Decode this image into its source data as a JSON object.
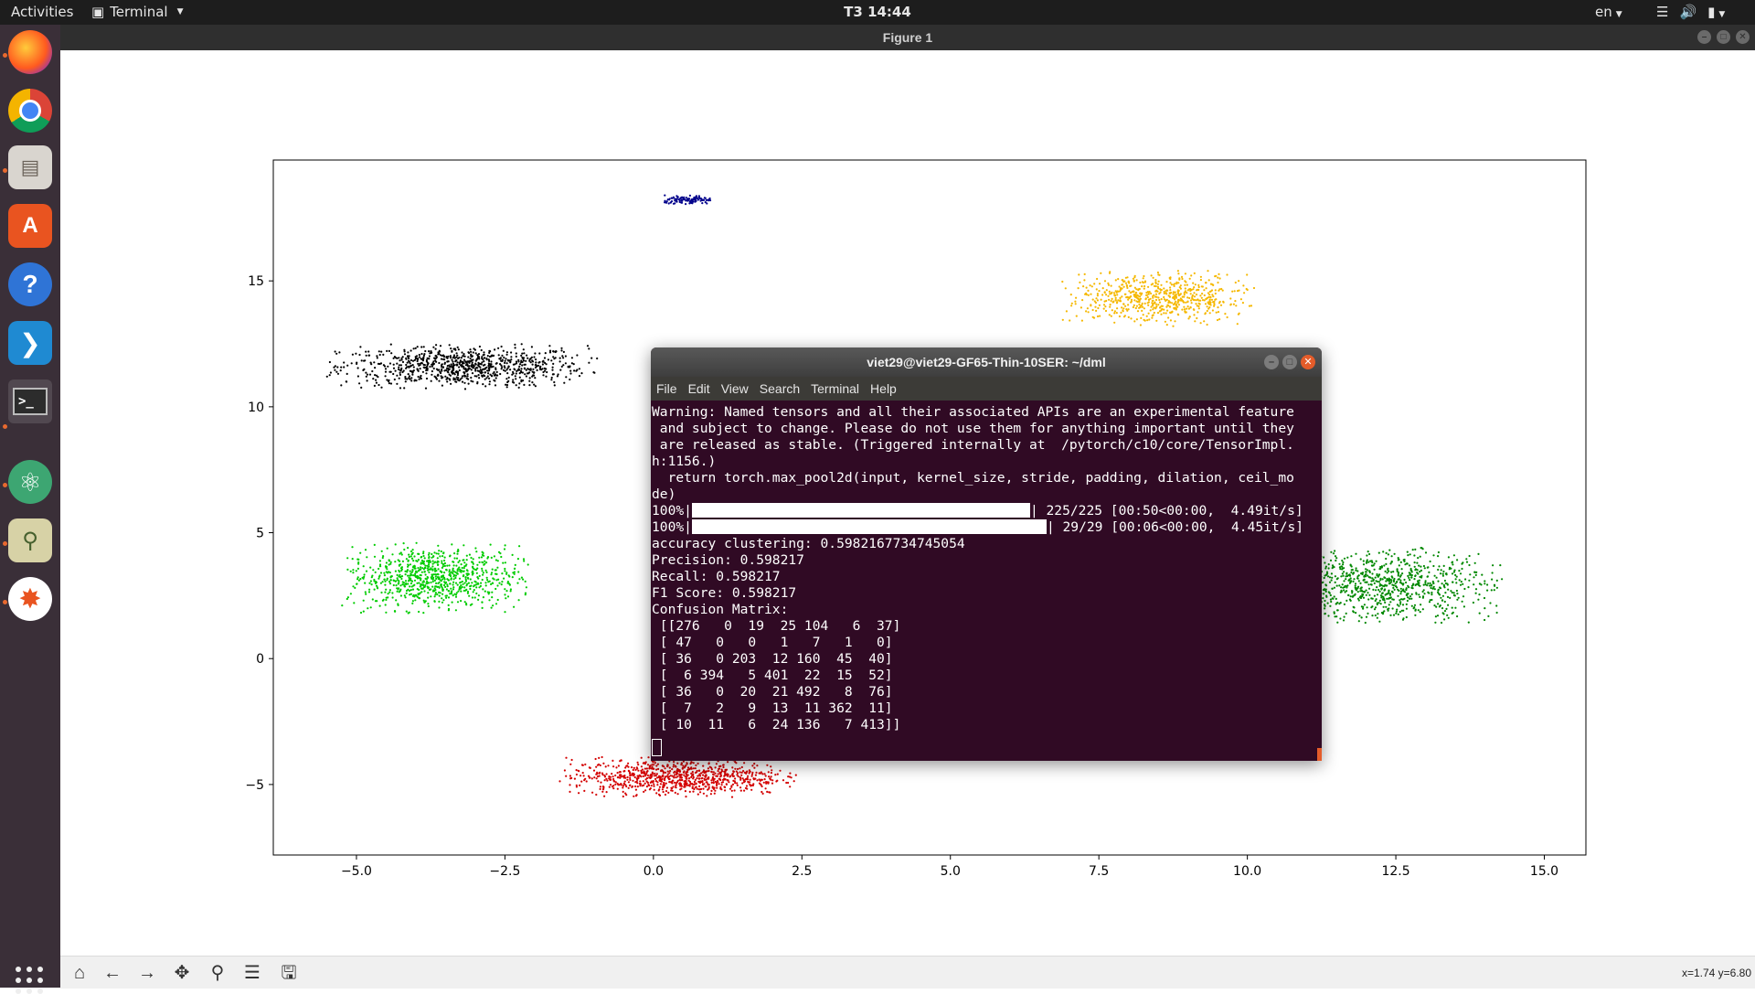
{
  "topbar": {
    "activities": "Activities",
    "app_name": "Terminal",
    "clock": "T3 14:44",
    "language": "en",
    "tray_icons": [
      "wifi-icon",
      "volume-icon",
      "battery-icon"
    ]
  },
  "window": {
    "title": "Figure 1"
  },
  "dock": {
    "apps": [
      {
        "name": "Firefox",
        "icon": "firefox-icon",
        "running": true
      },
      {
        "name": "Chromium",
        "icon": "chrome-icon",
        "running": false
      },
      {
        "name": "Files",
        "icon": "files-icon",
        "running": true
      },
      {
        "name": "Ubuntu Software",
        "icon": "software-icon",
        "running": false
      },
      {
        "name": "Help",
        "icon": "help-icon",
        "running": false
      },
      {
        "name": "Visual Studio Code",
        "icon": "vscode-icon",
        "running": false
      },
      {
        "name": "Terminal",
        "icon": "terminal-icon",
        "running": true
      },
      {
        "name": "Atom",
        "icon": "atom-icon",
        "running": true
      },
      {
        "name": "Image Viewer",
        "icon": "image-viewer-icon",
        "running": true
      },
      {
        "name": "Plot app",
        "icon": "plot-app-icon",
        "running": true
      }
    ],
    "show_apps_icon": "grid-icon"
  },
  "toolbar": {
    "buttons": [
      "home-icon",
      "back-icon",
      "forward-icon",
      "pan-icon",
      "zoom-icon",
      "configure-icon",
      "save-icon"
    ],
    "coordinates": "x=1.74 y=6.80"
  },
  "terminal": {
    "title": "viet29@viet29-GF65-Thin-10SER: ~/dml",
    "menu": [
      "File",
      "Edit",
      "View",
      "Search",
      "Terminal",
      "Help"
    ],
    "lines": [
      "Warning: Named tensors and all their associated APIs are an experimental feature",
      " and subject to change. Please do not use them for anything important until they",
      " are released as stable. (Triggered internally at  /pytorch/c10/core/TensorImpl.",
      "h:1156.)",
      "  return torch.max_pool2d(input, kernel_size, stride, padding, dilation, ceil_mo",
      "de)"
    ],
    "progress": [
      {
        "prefix": "100%|",
        "suffix": "| 225/225 [00:50<00:00,  4.49it/s]",
        "fraction": 1.0
      },
      {
        "prefix": "100%|",
        "suffix": "| 29/29 [00:06<00:00,  4.45it/s]",
        "fraction": 1.0
      }
    ],
    "results": [
      "accuracy clustering: 0.5982167734745054",
      "Precision: 0.598217",
      "Recall: 0.598217",
      "F1 Score: 0.598217",
      "Confusion Matrix:",
      " [[276   0  19  25 104   6  37]",
      " [ 47   0   0   1   7   1   0]",
      " [ 36   0 203  12 160  45  40]",
      " [  6 394   5 401  22  15  52]",
      " [ 36   0  20  21 492   8  76]",
      " [  7   2   9  13  11 362  11]",
      " [ 10  11   6  24 136   7 413]]"
    ]
  },
  "chart_data": {
    "type": "scatter",
    "title": "",
    "xlabel": "",
    "ylabel": "",
    "xlim": [
      -6.4,
      15.7
    ],
    "ylim": [
      -7.8,
      19.8
    ],
    "xticks": [
      "−5.0",
      "−2.5",
      "0.0",
      "2.5",
      "5.0",
      "7.5",
      "10.0",
      "12.5",
      "15.0"
    ],
    "xtick_values": [
      -5.0,
      -2.5,
      0.0,
      2.5,
      5.0,
      7.5,
      10.0,
      12.5,
      15.0
    ],
    "yticks": [
      "−5",
      "0",
      "5",
      "10",
      "15"
    ],
    "ytick_values": [
      -5,
      0,
      5,
      10,
      15
    ],
    "grid": false,
    "clusters": [
      {
        "color": "#000000",
        "center": [
          -3.2,
          11.6
        ],
        "spread": [
          2.3,
          0.9
        ],
        "count": 900
      },
      {
        "color": "#00cc00",
        "center": [
          -3.7,
          3.2
        ],
        "spread": [
          1.6,
          1.4
        ],
        "count": 900
      },
      {
        "color": "#d40000",
        "center": [
          0.4,
          -4.7
        ],
        "spread": [
          2.0,
          0.8
        ],
        "count": 900
      },
      {
        "color": "#00008b",
        "center": [
          0.6,
          18.2
        ],
        "spread": [
          0.45,
          0.2
        ],
        "count": 120
      },
      {
        "color": "#f5b800",
        "center": [
          8.5,
          14.3
        ],
        "spread": [
          1.7,
          1.1
        ],
        "count": 700
      },
      {
        "color": "#008800",
        "center": [
          12.3,
          2.9
        ],
        "spread": [
          2.0,
          1.5
        ],
        "count": 900
      }
    ]
  }
}
